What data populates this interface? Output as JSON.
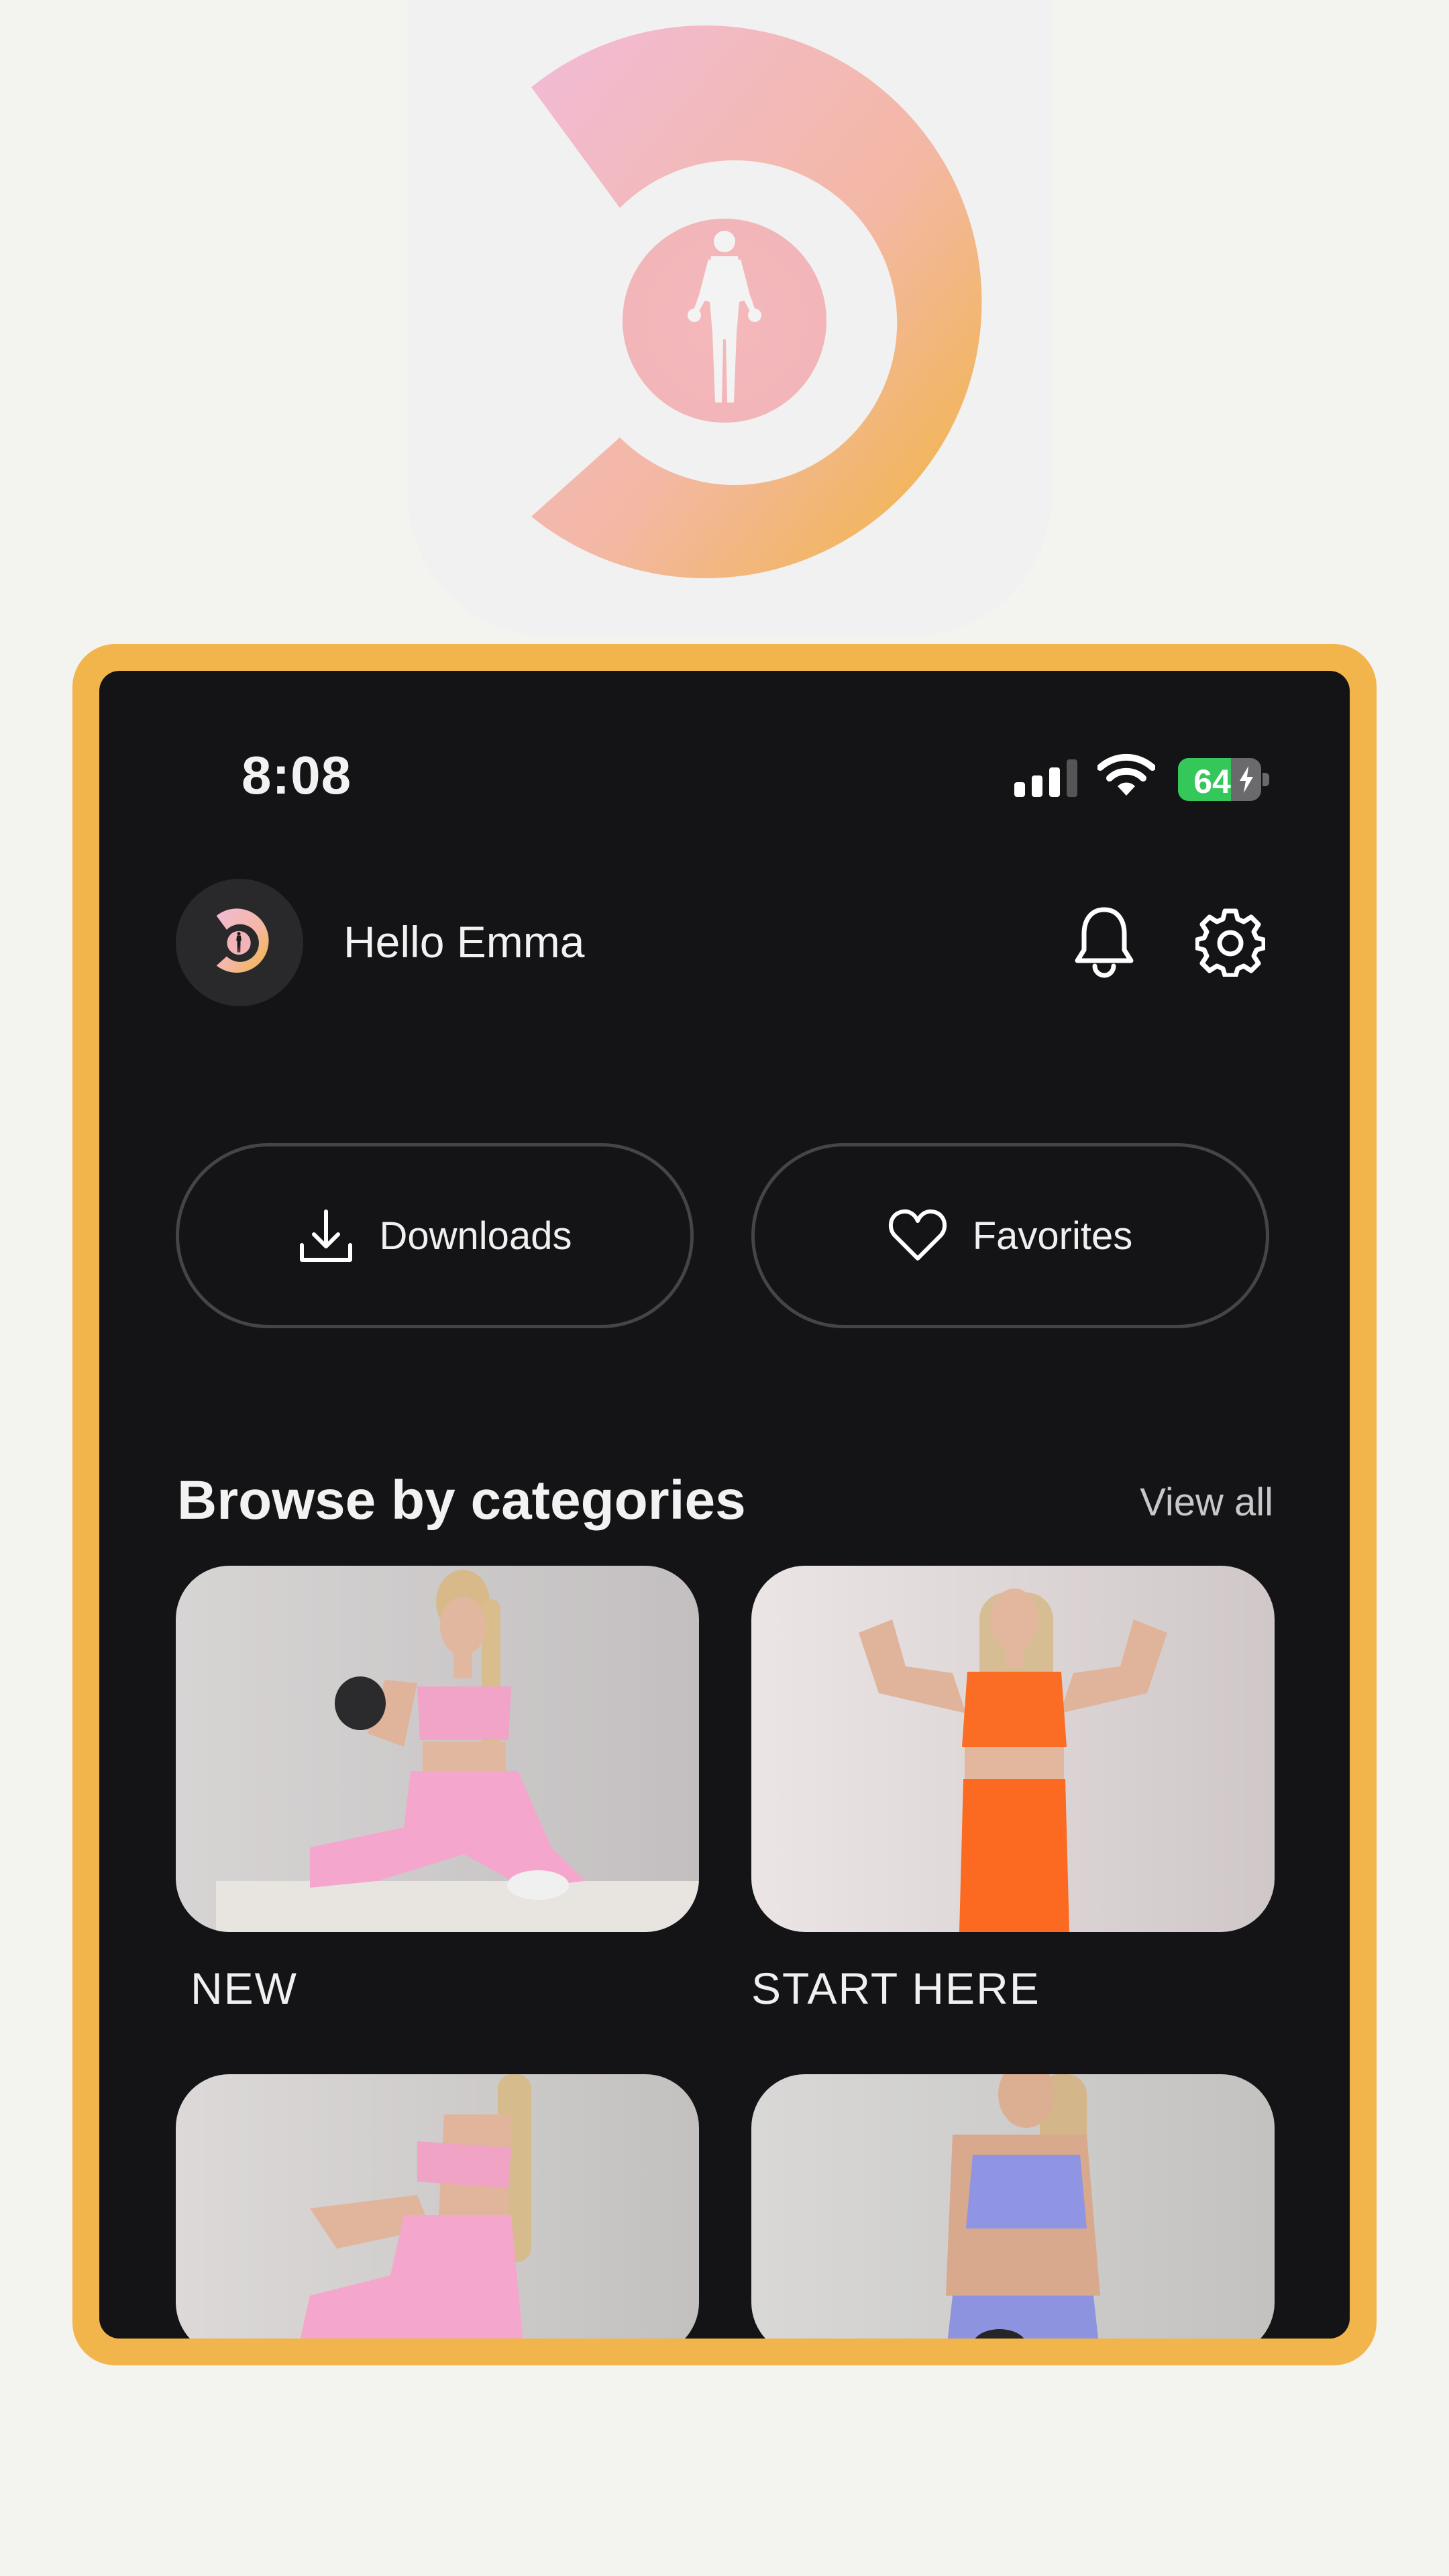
{
  "colors": {
    "frame": "#f1b54b",
    "screen": "#141416",
    "logo_gradient": [
      "#f2bbd7",
      "#f1b53c"
    ],
    "battery_fill": "#34c759"
  },
  "logo": {
    "icon": "c-logo-with-athlete-icon"
  },
  "status_bar": {
    "time": "8:08",
    "battery": "64",
    "battery_level_percent": 64,
    "icons": [
      "signal-icon",
      "wifi-icon",
      "battery-icon"
    ]
  },
  "header": {
    "greeting": "Hello Emma",
    "icons": [
      "bell-icon",
      "gear-icon"
    ]
  },
  "actions": {
    "downloads_label": "Downloads",
    "favorites_label": "Favorites"
  },
  "section": {
    "title": "Browse by categories",
    "view_all": "View all"
  },
  "categories": [
    {
      "label": "NEW"
    },
    {
      "label": "START HERE"
    },
    {
      "label": ""
    },
    {
      "label": ""
    }
  ]
}
